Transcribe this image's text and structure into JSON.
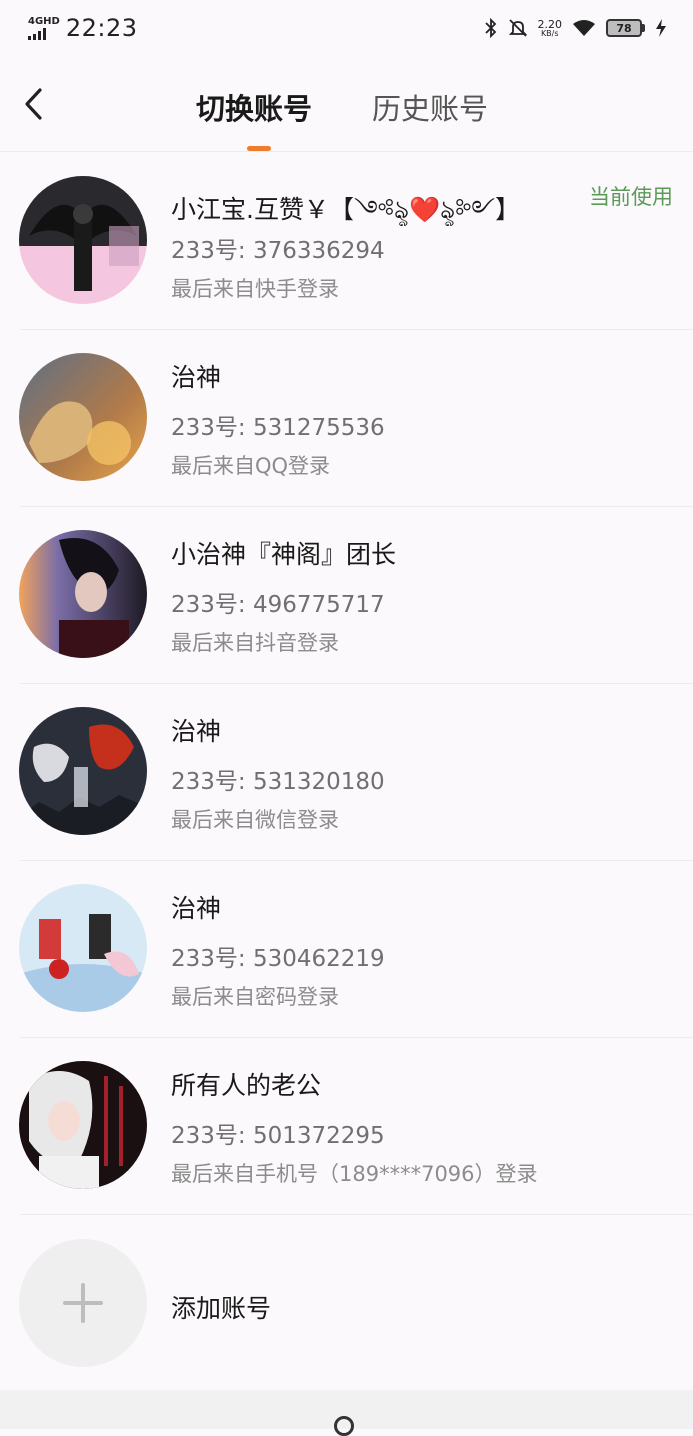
{
  "status_bar": {
    "network": "4GHD",
    "time": "22:23",
    "speed_value": "2.20",
    "speed_unit": "KB/s",
    "battery": "78",
    "icons": [
      "signal-icon",
      "bluetooth-icon",
      "mute-bell-icon",
      "wifi-icon",
      "battery-icon",
      "charging-icon"
    ]
  },
  "header": {
    "back_icon": "chevron-left-icon",
    "tab_active": "切换账号",
    "tab_inactive": "历史账号",
    "indicator_color": "#f07b2c"
  },
  "accounts": [
    {
      "name": "小江宝.互赞￥【༺ৡ❤️ৡ༻】",
      "id_label": "233号:",
      "id": "376336294",
      "source": "最后来自快手登录",
      "current": "当前使用"
    },
    {
      "name": "治神",
      "id_label": "233号:",
      "id": "531275536",
      "source": "最后来自QQ登录"
    },
    {
      "name": "小治神『神阁』团长",
      "id_label": "233号:",
      "id": "496775717",
      "source": "最后来自抖音登录"
    },
    {
      "name": "治神",
      "id_label": "233号:",
      "id": "531320180",
      "source": "最后来自微信登录"
    },
    {
      "name": "治神",
      "id_label": "233号:",
      "id": "530462219",
      "source": "最后来自密码登录"
    },
    {
      "name": "所有人的老公",
      "id_label": "233号:",
      "id": "501372295",
      "source": "最后来自手机号（189****7096）登录"
    }
  ],
  "add_account": {
    "label": "添加账号",
    "icon": "plus-icon"
  },
  "colors": {
    "current_tag": "#5b9a57",
    "background": "#fbf9fb"
  }
}
